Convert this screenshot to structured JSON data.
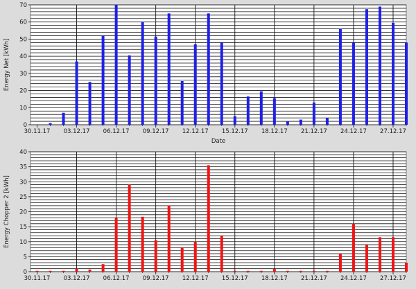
{
  "chart_data": [
    {
      "type": "bar",
      "xlabel": "Date",
      "ylabel": "Energy Net [kWh]",
      "ylim": [
        0,
        70
      ],
      "yticks": [
        0,
        10,
        20,
        30,
        40,
        50,
        60,
        70
      ],
      "grid": true,
      "color": "#1f1fe6",
      "x_start": "2017-11-30",
      "x_tick_labels": [
        "30.11.17",
        "03.12.17",
        "06.12.17",
        "09.12.17",
        "12.12.17",
        "15.12.17",
        "18.12.17",
        "21.12.17",
        "24.12.17",
        "27.12.17"
      ],
      "categories": [
        "30.11.17",
        "01.12.17",
        "02.12.17",
        "03.12.17",
        "04.12.17",
        "05.12.17",
        "06.12.17",
        "07.12.17",
        "08.12.17",
        "09.12.17",
        "10.12.17",
        "11.12.17",
        "12.12.17",
        "13.12.17",
        "14.12.17",
        "15.12.17",
        "16.12.17",
        "17.12.17",
        "18.12.17",
        "19.12.17",
        "20.12.17",
        "21.12.17",
        "22.12.17",
        "23.12.17",
        "24.12.17",
        "25.12.17",
        "26.12.17",
        "27.12.17",
        "28.12.17"
      ],
      "values": [
        0,
        1,
        7,
        37,
        25,
        52,
        70,
        40.5,
        60,
        51.5,
        65,
        25.5,
        47,
        65,
        48,
        5,
        16.5,
        19.5,
        15.5,
        2,
        3,
        13,
        4,
        56,
        48,
        67.5,
        69,
        59.5,
        48
      ]
    },
    {
      "type": "bar",
      "xlabel": "",
      "ylabel": "Energy Chopper 2 [kWh]",
      "ylim": [
        0,
        40
      ],
      "yticks": [
        0,
        5,
        10,
        15,
        20,
        25,
        30,
        35,
        40
      ],
      "grid": true,
      "color": "#f01414",
      "x_start": "2017-11-30",
      "x_tick_labels": [
        "30.11.17",
        "03.12.17",
        "06.12.17",
        "09.12.17",
        "12.12.17",
        "15.12.17",
        "18.12.17",
        "21.12.17",
        "24.12.17",
        "27.12.17"
      ],
      "categories": [
        "30.11.17",
        "01.12.17",
        "02.12.17",
        "03.12.17",
        "04.12.17",
        "05.12.17",
        "06.12.17",
        "07.12.17",
        "08.12.17",
        "09.12.17",
        "10.12.17",
        "11.12.17",
        "12.12.17",
        "13.12.17",
        "14.12.17",
        "15.12.17",
        "16.12.17",
        "17.12.17",
        "18.12.17",
        "19.12.17",
        "20.12.17",
        "21.12.17",
        "22.12.17",
        "23.12.17",
        "24.12.17",
        "25.12.17",
        "26.12.17",
        "27.12.17",
        "28.12.17"
      ],
      "values": [
        0.3,
        0.3,
        0.3,
        1,
        0.7,
        2.5,
        18,
        29,
        18.3,
        10.5,
        22,
        8,
        10,
        35.5,
        12,
        0.3,
        0.3,
        0.3,
        0.9,
        0.3,
        0.3,
        0.3,
        0.3,
        6,
        16,
        9,
        11.5,
        11.5,
        3
      ]
    }
  ]
}
